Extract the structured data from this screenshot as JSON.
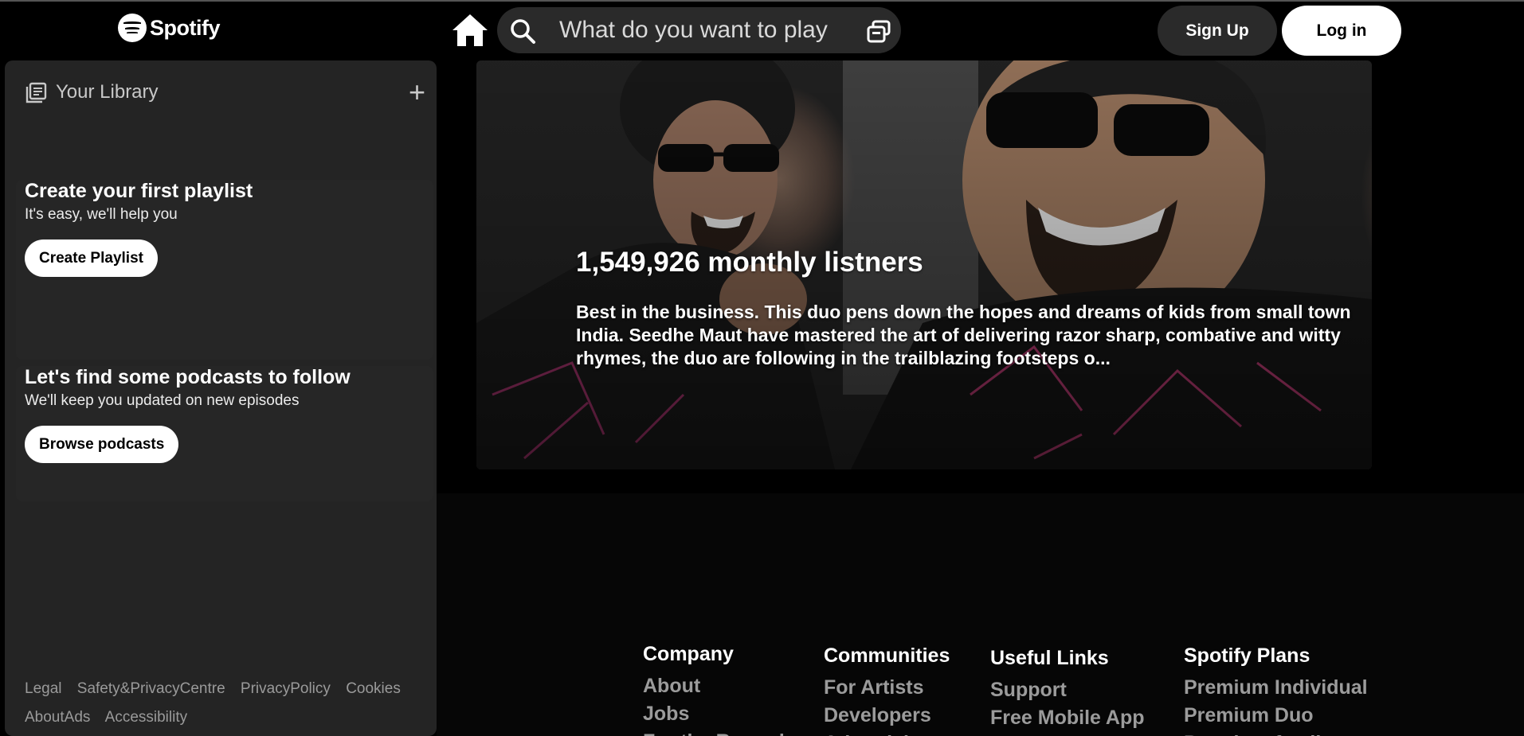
{
  "header": {
    "brand": "Spotify",
    "search_placeholder": "What do you want to play",
    "signup_label": "Sign Up",
    "login_label": "Log in",
    "icons": [
      "spotify-logo",
      "home-icon",
      "search-icon",
      "browse-icon"
    ]
  },
  "sidebar": {
    "library_title": "Your Library",
    "add_symbol": "+",
    "playlist_promo": {
      "title": "Create your first playlist",
      "subtitle": "It's easy, we'll help you",
      "button": "Create Playlist"
    },
    "podcast_promo": {
      "title": "Let's find some podcasts to follow",
      "subtitle": "We'll keep you updated on new episodes",
      "button": "Browse podcasts"
    },
    "legal_links": [
      "Legal",
      "Safety&PrivacyCentre",
      "PrivacyPolicy",
      "Cookies",
      "AboutAds",
      "Accessibility"
    ]
  },
  "artist": {
    "listeners": "1,549,926 monthly listners",
    "bio": "Best in the business. This duo pens down the hopes and dreams of kids from small town India. Seedhe Maut have mastered the art of delivering razor sharp, combative and witty rhymes, the duo are following in the trailblazing footsteps o..."
  },
  "footer": {
    "columns": [
      {
        "title": "Company",
        "links": [
          "About",
          "Jobs",
          "For the Record"
        ]
      },
      {
        "title": "Communities",
        "links": [
          "For Artists",
          "Developers",
          "Advertising"
        ]
      },
      {
        "title": "Useful Links",
        "links": [
          "Support",
          "Free Mobile App"
        ]
      },
      {
        "title": "Spotify Plans",
        "links": [
          "Premium Individual",
          "Premium Duo",
          "Premium family"
        ]
      }
    ]
  },
  "colors": {
    "background": "#000000",
    "panel": "#242424",
    "search_bg": "#2a2a2a",
    "muted_text": "#9b9b9b"
  }
}
